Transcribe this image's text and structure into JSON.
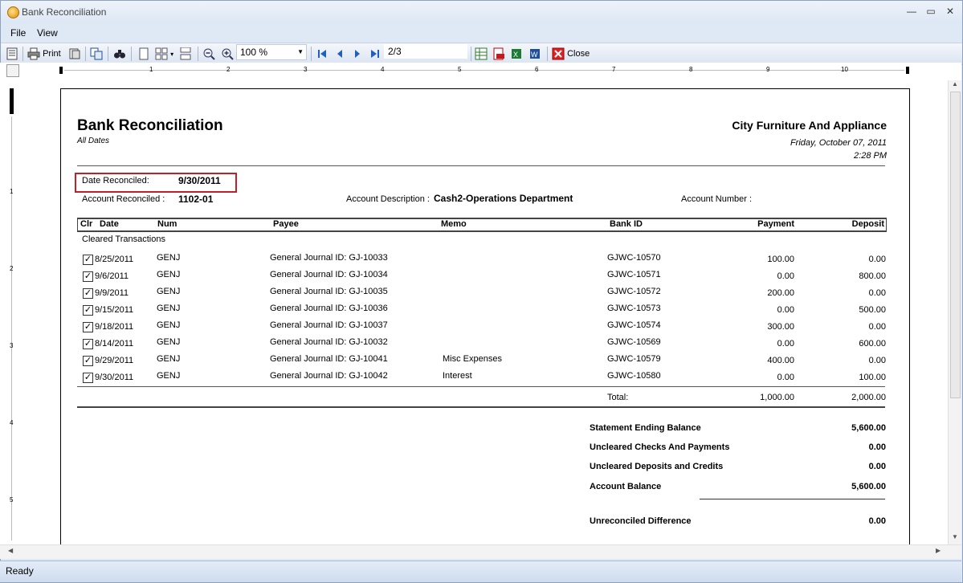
{
  "window": {
    "title": "Bank Reconciliation",
    "minimize": "—",
    "maximize": "▭",
    "close": "✕"
  },
  "menu": {
    "file": "File",
    "view": "View"
  },
  "toolbar": {
    "print_label": "Print",
    "zoom_value": "100 %",
    "page_indicator": "2/3",
    "close_label": "Close"
  },
  "ruler_numbers": [
    "1",
    "2",
    "3",
    "4",
    "5",
    "6",
    "7",
    "8",
    "9",
    "10"
  ],
  "ruler_v_numbers": [
    "1",
    "2",
    "3",
    "4",
    "5"
  ],
  "report": {
    "title": "Bank Reconciliation",
    "subtitle": "All Dates",
    "company": "City Furniture And Appliance",
    "print_date": "Friday, October 07, 2011",
    "print_time": "2:28 PM",
    "date_reconciled_label": "Date Reconciled:",
    "date_reconciled": "9/30/2011",
    "account_reconciled_label": "Account Reconciled :",
    "account_reconciled": "1102-01",
    "account_description_label": "Account Description :",
    "account_description": "Cash2-Operations Department",
    "account_number_label": "Account Number :",
    "columns": {
      "clr": "Clr",
      "date": "Date",
      "num": "Num",
      "payee": "Payee",
      "memo": "Memo",
      "bank_id": "Bank ID",
      "payment": "Payment",
      "deposit": "Deposit"
    },
    "section_label": "Cleared Transactions",
    "rows": [
      {
        "checked": true,
        "date": "8/25/2011",
        "num": "GENJ",
        "payee": "General Journal ID: GJ-10033",
        "memo": "",
        "bank_id": "GJWC-10570",
        "payment": "100.00",
        "deposit": "0.00"
      },
      {
        "checked": true,
        "date": "9/6/2011",
        "num": "GENJ",
        "payee": "General Journal ID: GJ-10034",
        "memo": "",
        "bank_id": "GJWC-10571",
        "payment": "0.00",
        "deposit": "800.00"
      },
      {
        "checked": true,
        "date": "9/9/2011",
        "num": "GENJ",
        "payee": "General Journal ID: GJ-10035",
        "memo": "",
        "bank_id": "GJWC-10572",
        "payment": "200.00",
        "deposit": "0.00"
      },
      {
        "checked": true,
        "date": "9/15/2011",
        "num": "GENJ",
        "payee": "General Journal ID: GJ-10036",
        "memo": "",
        "bank_id": "GJWC-10573",
        "payment": "0.00",
        "deposit": "500.00"
      },
      {
        "checked": true,
        "date": "9/18/2011",
        "num": "GENJ",
        "payee": "General Journal ID: GJ-10037",
        "memo": "",
        "bank_id": "GJWC-10574",
        "payment": "300.00",
        "deposit": "0.00"
      },
      {
        "checked": true,
        "date": "8/14/2011",
        "num": "GENJ",
        "payee": "General Journal ID: GJ-10032",
        "memo": "",
        "bank_id": "GJWC-10569",
        "payment": "0.00",
        "deposit": "600.00"
      },
      {
        "checked": true,
        "date": "9/29/2011",
        "num": "GENJ",
        "payee": "General Journal ID: GJ-10041",
        "memo": "Misc Expenses",
        "bank_id": "GJWC-10579",
        "payment": "400.00",
        "deposit": "0.00"
      },
      {
        "checked": true,
        "date": "9/30/2011",
        "num": "GENJ",
        "payee": "General Journal ID: GJ-10042",
        "memo": "Interest",
        "bank_id": "GJWC-10580",
        "payment": "0.00",
        "deposit": "100.00"
      }
    ],
    "total_label": "Total:",
    "total_payment": "1,000.00",
    "total_deposit": "2,000.00",
    "summary": [
      {
        "label": "Statement Ending Balance",
        "value": "5,600.00"
      },
      {
        "label": "Uncleared Checks And Payments",
        "value": "0.00"
      },
      {
        "label": "Uncleared Deposits and Credits",
        "value": "0.00"
      },
      {
        "label": "Account Balance",
        "value": "5,600.00"
      }
    ],
    "unreconciled_label": "Unreconciled Difference",
    "unreconciled_value": "0.00"
  },
  "status": {
    "text": "Ready"
  },
  "colors": {
    "highlight_box": "#c0202a",
    "accent": "#dfe8f5"
  }
}
